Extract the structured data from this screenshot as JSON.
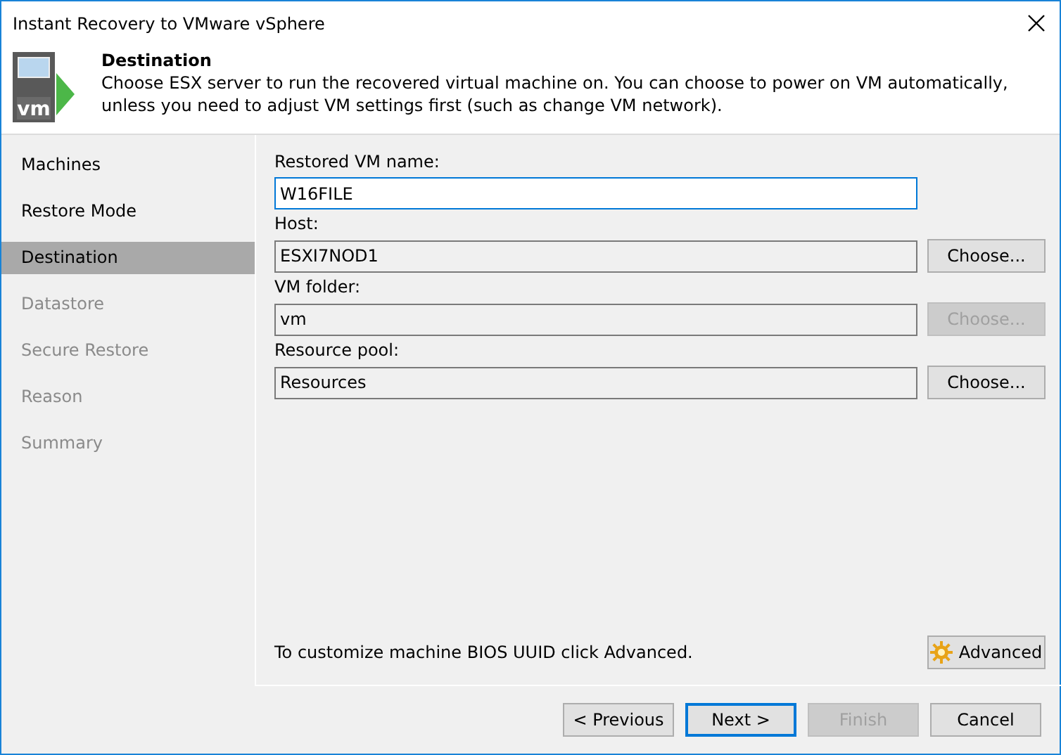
{
  "window": {
    "title": "Instant Recovery to VMware vSphere"
  },
  "header": {
    "title": "Destination",
    "description": "Choose ESX server to run the recovered virtual machine on. You can choose to power on VM automatically, unless you need to adjust VM settings first (such as change VM network).",
    "logo": "vm"
  },
  "steps": [
    {
      "label": "Machines",
      "selected": false,
      "disabled": false
    },
    {
      "label": "Restore Mode",
      "selected": false,
      "disabled": false
    },
    {
      "label": "Destination",
      "selected": true,
      "disabled": false
    },
    {
      "label": "Datastore",
      "selected": false,
      "disabled": true
    },
    {
      "label": "Secure Restore",
      "selected": false,
      "disabled": true
    },
    {
      "label": "Reason",
      "selected": false,
      "disabled": true
    },
    {
      "label": "Summary",
      "selected": false,
      "disabled": true
    }
  ],
  "fields": [
    {
      "label": "Restored VM name:",
      "value": "W16FILE",
      "readonly": false
    },
    {
      "label": "Host:",
      "value": "ESXI7NOD1",
      "readonly": true,
      "button": {
        "label": "Choose...",
        "disabled": false
      }
    },
    {
      "label": "VM folder:",
      "value": "vm",
      "readonly": true,
      "button": {
        "label": "Choose...",
        "disabled": true
      }
    },
    {
      "label": "Resource pool:",
      "value": "Resources",
      "readonly": true,
      "button": {
        "label": "Choose...",
        "disabled": false
      }
    }
  ],
  "hint": "To customize machine BIOS UUID click Advanced.",
  "advanced_button": {
    "label": "Advanced"
  },
  "footer_buttons": [
    {
      "label": "< Previous",
      "disabled": false,
      "default": false
    },
    {
      "label": "Next >",
      "disabled": false,
      "default": true
    },
    {
      "label": "Finish",
      "disabled": true,
      "default": false
    },
    {
      "label": "Cancel",
      "disabled": false,
      "default": false
    }
  ]
}
